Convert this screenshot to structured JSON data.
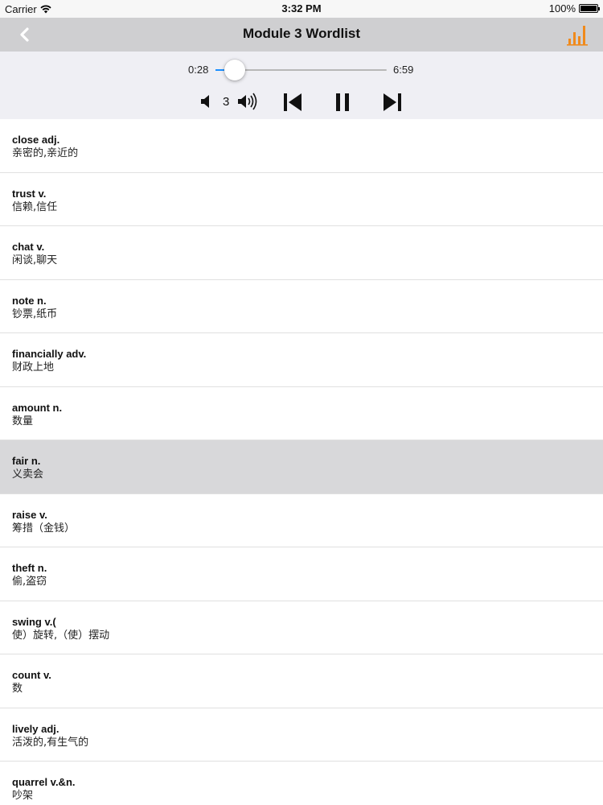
{
  "status_bar": {
    "carrier": "Carrier",
    "time": "3:32 PM",
    "battery": "100%"
  },
  "nav": {
    "title": "Module 3 Wordlist",
    "back_icon": "chevron-left-icon",
    "action_icon": "bar-chart-icon",
    "accent_color": "#f08a1c"
  },
  "player": {
    "current_time": "0:28",
    "total_time": "6:59",
    "progress": 0.067,
    "volume": "3",
    "accent_color": "#1a8fff"
  },
  "words": [
    {
      "term": "close adj.",
      "definition": "亲密的,亲近的",
      "selected": false
    },
    {
      "term": "trust v.",
      "definition": "信赖,信任",
      "selected": false
    },
    {
      "term": "chat v.",
      "definition": "闲谈,聊天",
      "selected": false
    },
    {
      "term": "note n.",
      "definition": "钞票,纸币",
      "selected": false
    },
    {
      "term": "financially adv.",
      "definition": "财政上地",
      "selected": false
    },
    {
      "term": "amount n.",
      "definition": "数量",
      "selected": false
    },
    {
      "term": "fair n.",
      "definition": "义卖会",
      "selected": true
    },
    {
      "term": "raise v.",
      "definition": "筹措（金钱）",
      "selected": false
    },
    {
      "term": "theft n.",
      "definition": "偷,盗窃",
      "selected": false
    },
    {
      "term": "swing v.(",
      "definition": "使）旋转,（使）摆动",
      "selected": false
    },
    {
      "term": "count v.",
      "definition": "数",
      "selected": false
    },
    {
      "term": "lively adj.",
      "definition": "活泼的,有生气的",
      "selected": false
    },
    {
      "term": "quarrel v.&n.",
      "definition": "吵架",
      "selected": false
    }
  ]
}
